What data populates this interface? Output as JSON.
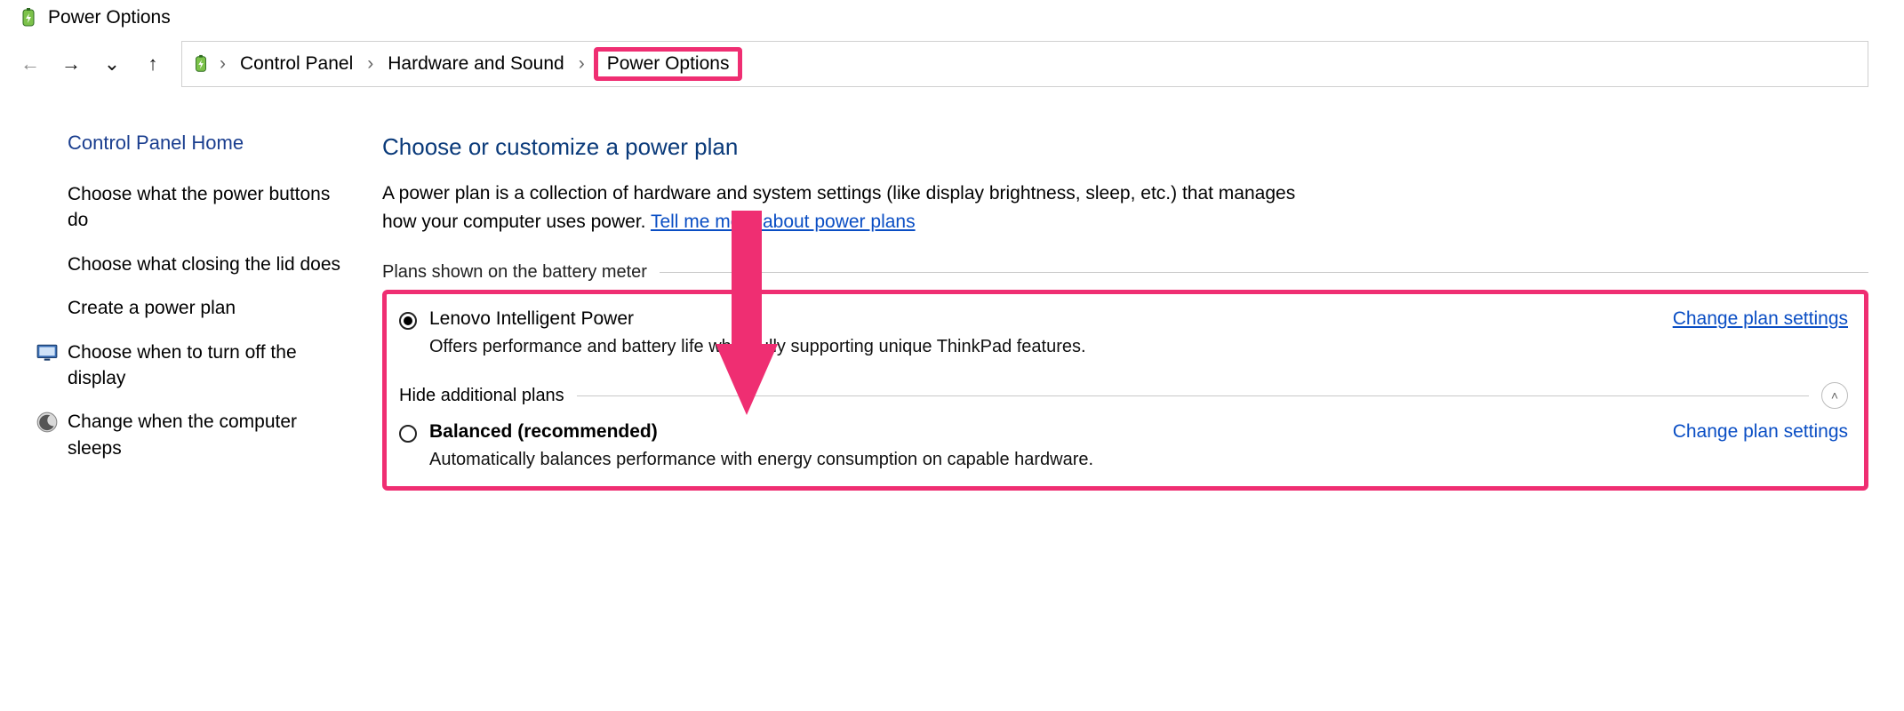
{
  "window": {
    "title": "Power Options"
  },
  "breadcrumb": {
    "items": [
      "Control Panel",
      "Hardware and Sound",
      "Power Options"
    ]
  },
  "sidebar": {
    "home": "Control Panel Home",
    "links": [
      "Choose what the power buttons do",
      "Choose what closing the lid does",
      "Create a power plan",
      "Choose when to turn off the display",
      "Change when the computer sleeps"
    ]
  },
  "main": {
    "title": "Choose or customize a power plan",
    "desc_part1": "A power plan is a collection of hardware and system settings (like display brightness, sleep, etc.) that manages how your computer uses power. ",
    "desc_link": "Tell me more about power plans",
    "section_label": "Plans shown on the battery meter",
    "hide_label": "Hide additional plans",
    "change_label": "Change plan settings",
    "plans": [
      {
        "name": "Lenovo Intelligent Power",
        "desc": "Offers performance and battery life while fully supporting unique ThinkPad features.",
        "selected": true
      },
      {
        "name": "Balanced (recommended)",
        "desc": "Automatically balances performance with energy consumption on capable hardware.",
        "selected": false
      }
    ]
  }
}
